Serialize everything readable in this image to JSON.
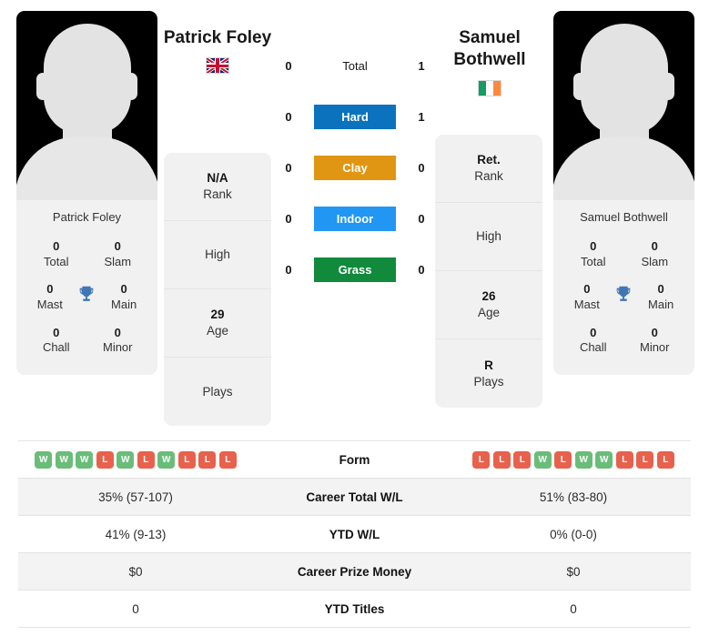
{
  "players": {
    "left": {
      "name": "Patrick Foley",
      "name_display": "Patrick Foley",
      "card_name": "Patrick Foley",
      "flag": "gb-flag-icon",
      "flag_country": "United Kingdom",
      "titles": [
        {
          "num": "0",
          "label": "Total"
        },
        {
          "num": "0",
          "label": "Slam"
        },
        {
          "num": "0",
          "label": "Mast"
        },
        {
          "num": "0",
          "label": "Main"
        },
        {
          "num": "0",
          "label": "Chall"
        },
        {
          "num": "0",
          "label": "Minor"
        }
      ],
      "info": [
        {
          "value": "N/A",
          "label": "Rank"
        },
        {
          "value": "",
          "label": "High"
        },
        {
          "value": "29",
          "label": "Age"
        },
        {
          "value": "",
          "label": "Plays"
        }
      ],
      "form": [
        "W",
        "W",
        "W",
        "L",
        "W",
        "L",
        "W",
        "L",
        "L",
        "L"
      ],
      "surface_wins": {
        "total": "0",
        "hard": "0",
        "clay": "0",
        "indoor": "0",
        "grass": "0"
      },
      "stats": {
        "career_total_wl": "35% (57-107)",
        "ytd_wl": "41% (9-13)",
        "career_prize_money": "$0",
        "ytd_titles": "0"
      }
    },
    "right": {
      "name": "Samuel Bothwell",
      "name_display": "Samuel\nBothwell",
      "card_name": "Samuel Bothwell",
      "flag": "ie-flag-icon",
      "flag_country": "Ireland",
      "titles": [
        {
          "num": "0",
          "label": "Total"
        },
        {
          "num": "0",
          "label": "Slam"
        },
        {
          "num": "0",
          "label": "Mast"
        },
        {
          "num": "0",
          "label": "Main"
        },
        {
          "num": "0",
          "label": "Chall"
        },
        {
          "num": "0",
          "label": "Minor"
        }
      ],
      "info": [
        {
          "value": "Ret.",
          "label": "Rank"
        },
        {
          "value": "",
          "label": "High"
        },
        {
          "value": "26",
          "label": "Age"
        },
        {
          "value": "R",
          "label": "Plays"
        }
      ],
      "form": [
        "L",
        "L",
        "L",
        "W",
        "L",
        "W",
        "W",
        "L",
        "L",
        "L"
      ],
      "surface_wins": {
        "total": "1",
        "hard": "1",
        "clay": "0",
        "indoor": "0",
        "grass": "0"
      },
      "stats": {
        "career_total_wl": "51% (83-80)",
        "ytd_wl": "0% (0-0)",
        "career_prize_money": "$0",
        "ytd_titles": "0"
      }
    }
  },
  "surfaces": [
    {
      "key": "total",
      "label": "Total",
      "color": "transparent",
      "text_color": "#151515",
      "plain": true
    },
    {
      "key": "hard",
      "label": "Hard",
      "color": "#0b72bd",
      "text_color": "#ffffff",
      "plain": false
    },
    {
      "key": "clay",
      "label": "Clay",
      "color": "#e09612",
      "text_color": "#ffffff",
      "plain": false
    },
    {
      "key": "indoor",
      "label": "Indoor",
      "color": "#2196f3",
      "text_color": "#ffffff",
      "plain": false
    },
    {
      "key": "grass",
      "label": "Grass",
      "color": "#128a3c",
      "text_color": "#ffffff",
      "plain": false
    }
  ],
  "table": {
    "rows": [
      {
        "label": "Form",
        "type": "form"
      },
      {
        "label": "Career Total W/L",
        "type": "text",
        "left": "35% (57-107)",
        "right": "51% (83-80)"
      },
      {
        "label": "YTD W/L",
        "type": "text",
        "left": "41% (9-13)",
        "right": "0% (0-0)"
      },
      {
        "label": "Career Prize Money",
        "type": "text",
        "left": "$0",
        "right": "$0"
      },
      {
        "label": "YTD Titles",
        "type": "text",
        "left": "0",
        "right": "0"
      }
    ]
  },
  "colors": {
    "win": "#6abd79",
    "loss": "#e8614c",
    "trophy": "#4176b4",
    "panel_bg": "#f1f1f1",
    "row_alt_bg": "#f3f3f3"
  },
  "icons": {
    "trophy": "trophy-icon"
  }
}
